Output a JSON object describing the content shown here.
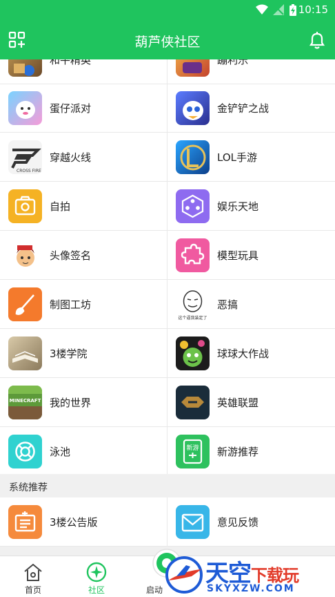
{
  "status_bar": {
    "time": "10:15"
  },
  "header": {
    "title": "葫芦侠社区"
  },
  "colors": {
    "brand": "#1fc45e",
    "divider": "#e8e8e8",
    "section_bg": "#f0f0f0"
  },
  "partial_row": {
    "left_label": "和平精英",
    "right_label": "蹦利乐"
  },
  "grid": [
    [
      {
        "label": "蛋仔派对",
        "icon": "eggy-party-icon"
      },
      {
        "label": "金铲铲之战",
        "icon": "golden-spatula-icon"
      }
    ],
    [
      {
        "label": "穿越火线",
        "icon": "crossfire-icon"
      },
      {
        "label": "LOL手游",
        "icon": "lol-mobile-icon"
      }
    ],
    [
      {
        "label": "自拍",
        "icon": "camera-icon"
      },
      {
        "label": "娱乐天地",
        "icon": "dice-icon"
      }
    ],
    [
      {
        "label": "头像签名",
        "icon": "avatar-character-icon"
      },
      {
        "label": "模型玩具",
        "icon": "puzzle-icon"
      }
    ],
    [
      {
        "label": "制图工坊",
        "icon": "brush-icon"
      },
      {
        "label": "恶搞",
        "icon": "meme-face-icon",
        "icon_caption": "这个逼我装定了"
      }
    ],
    [
      {
        "label": "3楼学院",
        "icon": "book-icon"
      },
      {
        "label": "球球大作战",
        "icon": "ball-battle-icon"
      }
    ],
    [
      {
        "label": "我的世界",
        "icon": "minecraft-icon",
        "icon_caption": "MINECRAFT"
      },
      {
        "label": "英雄联盟",
        "icon": "league-of-legends-icon"
      }
    ],
    [
      {
        "label": "泳池",
        "icon": "lifebuoy-icon"
      },
      {
        "label": "新游推荐",
        "icon": "new-game-icon",
        "icon_caption": "新游"
      }
    ]
  ],
  "section": {
    "title": "系统推荐"
  },
  "system_row": [
    {
      "label": "3楼公告版",
      "icon": "notice-board-icon"
    },
    {
      "label": "意见反馈",
      "icon": "feedback-mail-icon"
    }
  ],
  "tabs": [
    {
      "label": "首页",
      "icon": "home-icon",
      "active": false
    },
    {
      "label": "社区",
      "icon": "community-icon",
      "active": true
    },
    {
      "label": "启动",
      "icon": "launch-icon",
      "active": false
    }
  ],
  "watermark": {
    "main": "天空",
    "accent": "下载玩",
    "domain": "SKYXZW.COM"
  }
}
